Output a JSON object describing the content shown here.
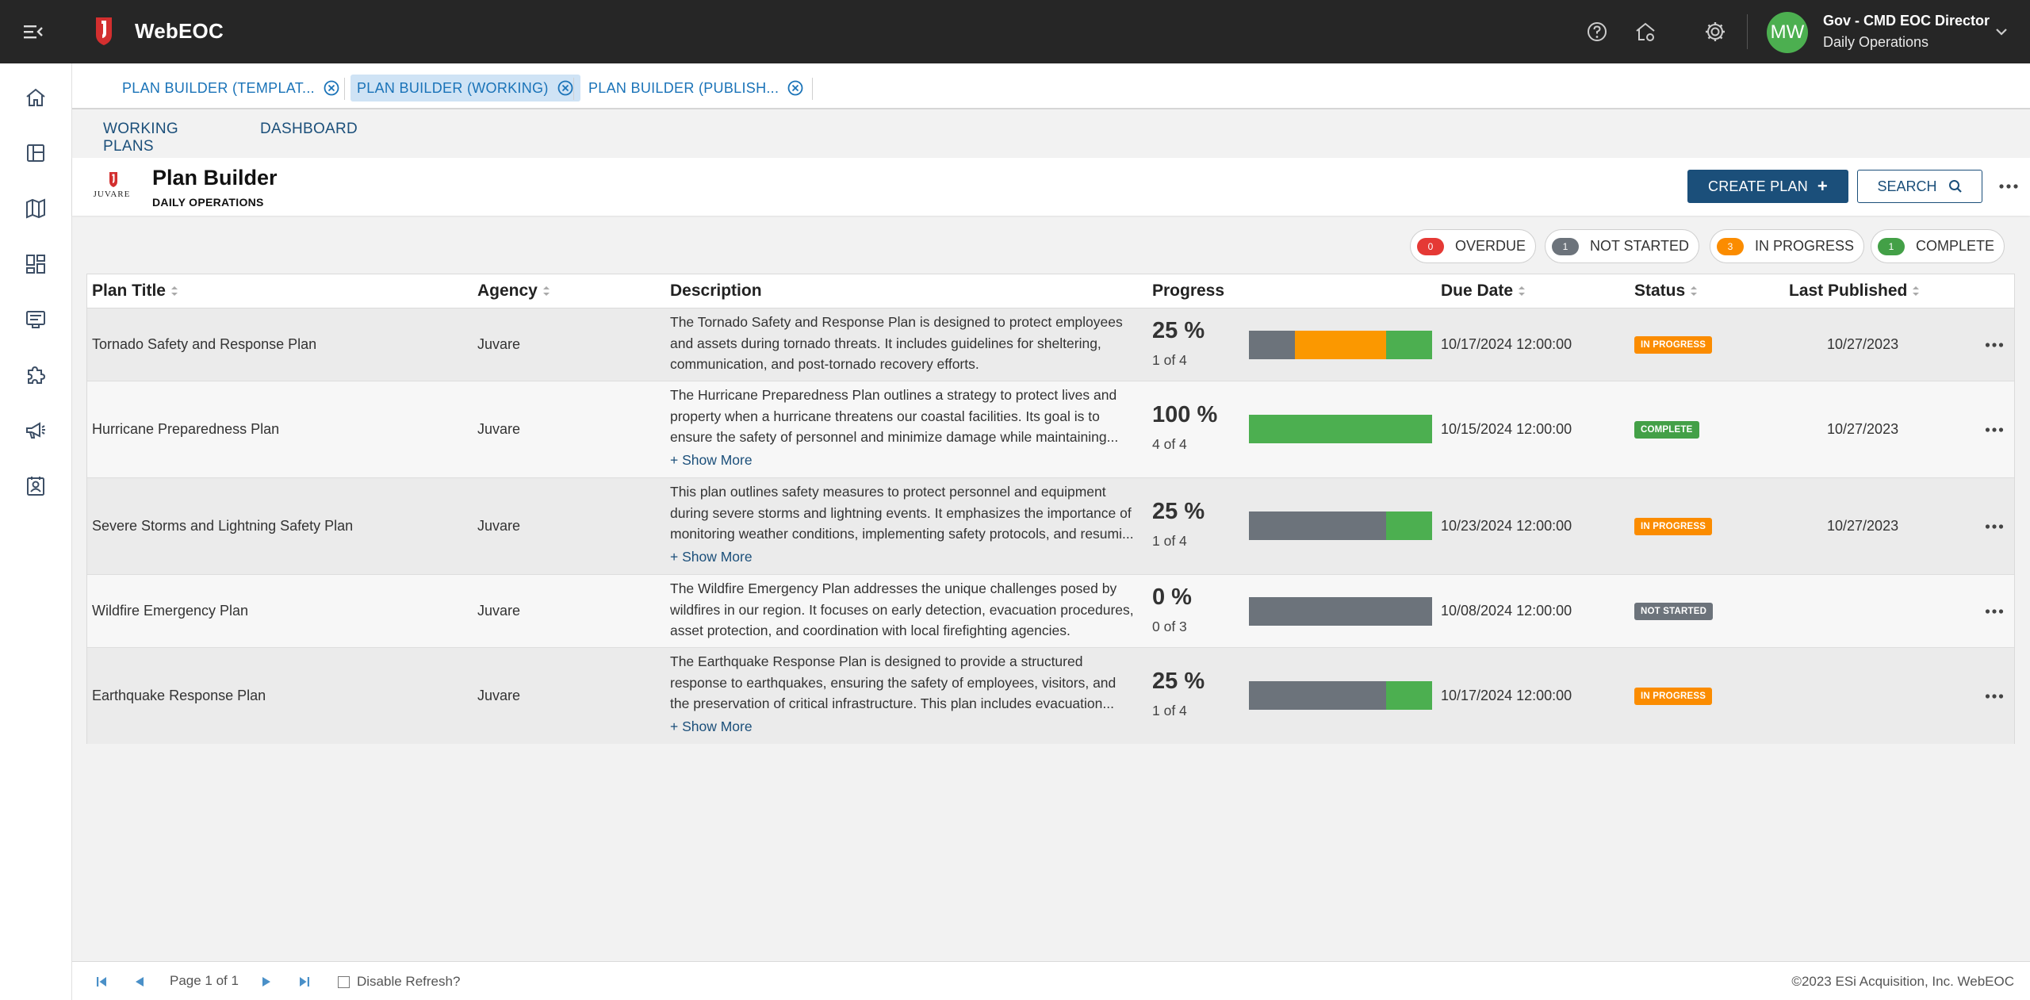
{
  "app": {
    "name": "WebEOC",
    "user_initials": "MW",
    "user_name": "Gov - CMD EOC Director",
    "user_position": "Daily Operations"
  },
  "icons": {
    "menu": "menu-collapse-icon",
    "help": "help-icon",
    "home": "home-settings-icon",
    "settings": "gear-icon",
    "caret": "chevron-down-icon"
  },
  "left_nav": [
    "home-icon",
    "layout-icon",
    "map-icon",
    "dashboard-icon",
    "boards-icon",
    "plugins-icon",
    "announcements-icon",
    "contacts-icon"
  ],
  "board_tabs": [
    {
      "label": "PLAN BUILDER (TEMPLAT..."
    },
    {
      "label": "PLAN BUILDER (WORKING)"
    },
    {
      "label": "PLAN BUILDER (PUBLISH..."
    }
  ],
  "sub_tabs": [
    {
      "label": "WORKING PLANS"
    },
    {
      "label": "DASHBOARD"
    }
  ],
  "header": {
    "logo_text": "JUVARE",
    "title": "Plan Builder",
    "subtitle": "DAILY OPERATIONS",
    "create_label": "CREATE PLAN",
    "create_plus": "+",
    "search_label": "SEARCH"
  },
  "chips": [
    {
      "count": "0",
      "label": "OVERDUE",
      "color": "#e53935"
    },
    {
      "count": "1",
      "label": "NOT STARTED",
      "color": "#6c737b"
    },
    {
      "count": "3",
      "label": "IN PROGRESS",
      "color": "#fb8c00"
    },
    {
      "count": "1",
      "label": "COMPLETE",
      "color": "#43a047"
    }
  ],
  "table": {
    "columns": [
      "Plan Title",
      "Agency",
      "Description",
      "Progress",
      "Due Date",
      "Status",
      "Last Published"
    ],
    "show_more_label": "+ Show More",
    "rows": [
      {
        "title": "Tornado Safety and Response Plan",
        "agency": "Juvare",
        "description": "The Tornado Safety and Response Plan is designed to protect employees and assets during tornado threats. It includes guidelines for sheltering, communication, and post-tornado recovery efforts.",
        "show_more": false,
        "percent": "25 %",
        "fraction": "1 of 4",
        "progress_segments": [
          {
            "status": "not-started",
            "fraction": 0.25,
            "color": "#6c737b"
          },
          {
            "status": "in-progress",
            "fraction": 0.5,
            "color": "#fb9800"
          },
          {
            "status": "complete",
            "fraction": 0.25,
            "color": "#4caf50"
          }
        ],
        "due_date": "10/17/2024 12:00:00",
        "status": "IN PROGRESS",
        "status_color": "#fb8c00",
        "last_published": "10/27/2023"
      },
      {
        "title": "Hurricane Preparedness Plan",
        "agency": "Juvare",
        "description": "The Hurricane Preparedness Plan outlines a strategy to protect lives and property when a hurricane threatens our coastal facilities. Its goal is to ensure the safety of personnel and minimize damage while maintaining...",
        "show_more": true,
        "percent": "100 %",
        "fraction": "4 of 4",
        "progress_segments": [
          {
            "status": "complete",
            "fraction": 1.0,
            "color": "#4caf50"
          }
        ],
        "due_date": "10/15/2024 12:00:00",
        "status": "COMPLETE",
        "status_color": "#43a047",
        "last_published": "10/27/2023"
      },
      {
        "title": "Severe Storms and Lightning Safety Plan",
        "agency": "Juvare",
        "description": "This plan outlines safety measures to protect personnel and equipment during severe storms and lightning events. It emphasizes the importance of monitoring weather conditions, implementing safety protocols, and resumi...",
        "show_more": true,
        "percent": "25 %",
        "fraction": "1 of 4",
        "progress_segments": [
          {
            "status": "not-started",
            "fraction": 0.75,
            "color": "#6c737b"
          },
          {
            "status": "complete",
            "fraction": 0.25,
            "color": "#4caf50"
          }
        ],
        "due_date": "10/23/2024 12:00:00",
        "status": "IN PROGRESS",
        "status_color": "#fb8c00",
        "last_published": "10/27/2023"
      },
      {
        "title": "Wildfire Emergency Plan",
        "agency": "Juvare",
        "description": "The Wildfire Emergency Plan addresses the unique challenges posed by wildfires in our region. It focuses on early detection, evacuation procedures, asset protection, and coordination with local firefighting agencies.",
        "show_more": false,
        "percent": "0 %",
        "fraction": "0 of 3",
        "progress_segments": [
          {
            "status": "not-started",
            "fraction": 1.0,
            "color": "#6c737b"
          }
        ],
        "due_date": "10/08/2024 12:00:00",
        "status": "NOT STARTED",
        "status_color": "#6c737b",
        "last_published": ""
      },
      {
        "title": "Earthquake Response Plan",
        "agency": "Juvare",
        "description": "The Earthquake Response Plan is designed to provide a structured response to earthquakes, ensuring the safety of employees, visitors, and the preservation of critical infrastructure. This plan includes evacuation...",
        "show_more": true,
        "percent": "25 %",
        "fraction": "1 of 4",
        "progress_segments": [
          {
            "status": "not-started",
            "fraction": 0.75,
            "color": "#6c737b"
          },
          {
            "status": "complete",
            "fraction": 0.25,
            "color": "#4caf50"
          }
        ],
        "due_date": "10/17/2024 12:00:00",
        "status": "IN PROGRESS",
        "status_color": "#fb8c00",
        "last_published": ""
      }
    ]
  },
  "footer": {
    "page_text": "Page 1 of 1",
    "disable_refresh_label": "Disable Refresh?",
    "copyright": "©2023 ESi Acquisition, Inc. WebEOC"
  },
  "colors": {
    "topbar": "#262626",
    "primary": "#1b4f7a",
    "link": "#1a73b8",
    "accent_red": "#d32f2f"
  }
}
